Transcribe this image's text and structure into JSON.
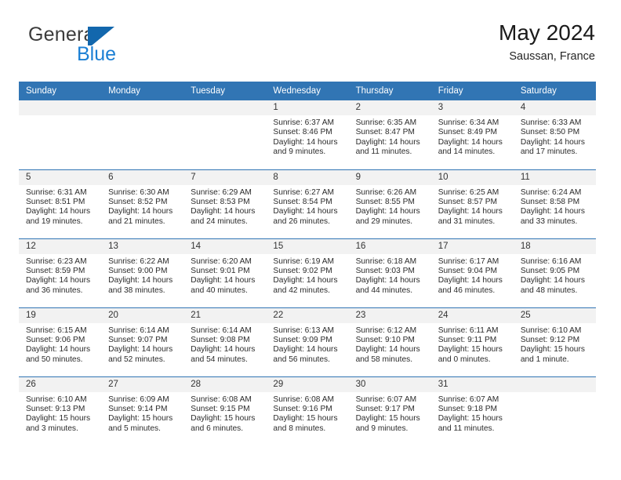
{
  "brand": {
    "name_top": "General",
    "name_bottom": "Blue",
    "flag_icon": "blue-flag-icon",
    "colors": {
      "top_text": "#3c3c3c",
      "bottom_text": "#1b7fd4",
      "flag": "#1267ad"
    }
  },
  "header": {
    "title": "May 2024",
    "subtitle": "Saussan, France"
  },
  "theme": {
    "header_blue": "#3175b4",
    "daynum_band": "#f2f2f2",
    "grid_line": "#3175b4"
  },
  "calendar": {
    "weekday_headers": [
      "Sunday",
      "Monday",
      "Tuesday",
      "Wednesday",
      "Thursday",
      "Friday",
      "Saturday"
    ],
    "weeks": [
      [
        {
          "day": "",
          "blank": true
        },
        {
          "day": "",
          "blank": true
        },
        {
          "day": "",
          "blank": true
        },
        {
          "day": "1",
          "sunrise": "Sunrise: 6:37 AM",
          "sunset": "Sunset: 8:46 PM",
          "daylight_1": "Daylight: 14 hours",
          "daylight_2": "and 9 minutes."
        },
        {
          "day": "2",
          "sunrise": "Sunrise: 6:35 AM",
          "sunset": "Sunset: 8:47 PM",
          "daylight_1": "Daylight: 14 hours",
          "daylight_2": "and 11 minutes."
        },
        {
          "day": "3",
          "sunrise": "Sunrise: 6:34 AM",
          "sunset": "Sunset: 8:49 PM",
          "daylight_1": "Daylight: 14 hours",
          "daylight_2": "and 14 minutes."
        },
        {
          "day": "4",
          "sunrise": "Sunrise: 6:33 AM",
          "sunset": "Sunset: 8:50 PM",
          "daylight_1": "Daylight: 14 hours",
          "daylight_2": "and 17 minutes."
        }
      ],
      [
        {
          "day": "5",
          "sunrise": "Sunrise: 6:31 AM",
          "sunset": "Sunset: 8:51 PM",
          "daylight_1": "Daylight: 14 hours",
          "daylight_2": "and 19 minutes."
        },
        {
          "day": "6",
          "sunrise": "Sunrise: 6:30 AM",
          "sunset": "Sunset: 8:52 PM",
          "daylight_1": "Daylight: 14 hours",
          "daylight_2": "and 21 minutes."
        },
        {
          "day": "7",
          "sunrise": "Sunrise: 6:29 AM",
          "sunset": "Sunset: 8:53 PM",
          "daylight_1": "Daylight: 14 hours",
          "daylight_2": "and 24 minutes."
        },
        {
          "day": "8",
          "sunrise": "Sunrise: 6:27 AM",
          "sunset": "Sunset: 8:54 PM",
          "daylight_1": "Daylight: 14 hours",
          "daylight_2": "and 26 minutes."
        },
        {
          "day": "9",
          "sunrise": "Sunrise: 6:26 AM",
          "sunset": "Sunset: 8:55 PM",
          "daylight_1": "Daylight: 14 hours",
          "daylight_2": "and 29 minutes."
        },
        {
          "day": "10",
          "sunrise": "Sunrise: 6:25 AM",
          "sunset": "Sunset: 8:57 PM",
          "daylight_1": "Daylight: 14 hours",
          "daylight_2": "and 31 minutes."
        },
        {
          "day": "11",
          "sunrise": "Sunrise: 6:24 AM",
          "sunset": "Sunset: 8:58 PM",
          "daylight_1": "Daylight: 14 hours",
          "daylight_2": "and 33 minutes."
        }
      ],
      [
        {
          "day": "12",
          "sunrise": "Sunrise: 6:23 AM",
          "sunset": "Sunset: 8:59 PM",
          "daylight_1": "Daylight: 14 hours",
          "daylight_2": "and 36 minutes."
        },
        {
          "day": "13",
          "sunrise": "Sunrise: 6:22 AM",
          "sunset": "Sunset: 9:00 PM",
          "daylight_1": "Daylight: 14 hours",
          "daylight_2": "and 38 minutes."
        },
        {
          "day": "14",
          "sunrise": "Sunrise: 6:20 AM",
          "sunset": "Sunset: 9:01 PM",
          "daylight_1": "Daylight: 14 hours",
          "daylight_2": "and 40 minutes."
        },
        {
          "day": "15",
          "sunrise": "Sunrise: 6:19 AM",
          "sunset": "Sunset: 9:02 PM",
          "daylight_1": "Daylight: 14 hours",
          "daylight_2": "and 42 minutes."
        },
        {
          "day": "16",
          "sunrise": "Sunrise: 6:18 AM",
          "sunset": "Sunset: 9:03 PM",
          "daylight_1": "Daylight: 14 hours",
          "daylight_2": "and 44 minutes."
        },
        {
          "day": "17",
          "sunrise": "Sunrise: 6:17 AM",
          "sunset": "Sunset: 9:04 PM",
          "daylight_1": "Daylight: 14 hours",
          "daylight_2": "and 46 minutes."
        },
        {
          "day": "18",
          "sunrise": "Sunrise: 6:16 AM",
          "sunset": "Sunset: 9:05 PM",
          "daylight_1": "Daylight: 14 hours",
          "daylight_2": "and 48 minutes."
        }
      ],
      [
        {
          "day": "19",
          "sunrise": "Sunrise: 6:15 AM",
          "sunset": "Sunset: 9:06 PM",
          "daylight_1": "Daylight: 14 hours",
          "daylight_2": "and 50 minutes."
        },
        {
          "day": "20",
          "sunrise": "Sunrise: 6:14 AM",
          "sunset": "Sunset: 9:07 PM",
          "daylight_1": "Daylight: 14 hours",
          "daylight_2": "and 52 minutes."
        },
        {
          "day": "21",
          "sunrise": "Sunrise: 6:14 AM",
          "sunset": "Sunset: 9:08 PM",
          "daylight_1": "Daylight: 14 hours",
          "daylight_2": "and 54 minutes."
        },
        {
          "day": "22",
          "sunrise": "Sunrise: 6:13 AM",
          "sunset": "Sunset: 9:09 PM",
          "daylight_1": "Daylight: 14 hours",
          "daylight_2": "and 56 minutes."
        },
        {
          "day": "23",
          "sunrise": "Sunrise: 6:12 AM",
          "sunset": "Sunset: 9:10 PM",
          "daylight_1": "Daylight: 14 hours",
          "daylight_2": "and 58 minutes."
        },
        {
          "day": "24",
          "sunrise": "Sunrise: 6:11 AM",
          "sunset": "Sunset: 9:11 PM",
          "daylight_1": "Daylight: 15 hours",
          "daylight_2": "and 0 minutes."
        },
        {
          "day": "25",
          "sunrise": "Sunrise: 6:10 AM",
          "sunset": "Sunset: 9:12 PM",
          "daylight_1": "Daylight: 15 hours",
          "daylight_2": "and 1 minute."
        }
      ],
      [
        {
          "day": "26",
          "sunrise": "Sunrise: 6:10 AM",
          "sunset": "Sunset: 9:13 PM",
          "daylight_1": "Daylight: 15 hours",
          "daylight_2": "and 3 minutes."
        },
        {
          "day": "27",
          "sunrise": "Sunrise: 6:09 AM",
          "sunset": "Sunset: 9:14 PM",
          "daylight_1": "Daylight: 15 hours",
          "daylight_2": "and 5 minutes."
        },
        {
          "day": "28",
          "sunrise": "Sunrise: 6:08 AM",
          "sunset": "Sunset: 9:15 PM",
          "daylight_1": "Daylight: 15 hours",
          "daylight_2": "and 6 minutes."
        },
        {
          "day": "29",
          "sunrise": "Sunrise: 6:08 AM",
          "sunset": "Sunset: 9:16 PM",
          "daylight_1": "Daylight: 15 hours",
          "daylight_2": "and 8 minutes."
        },
        {
          "day": "30",
          "sunrise": "Sunrise: 6:07 AM",
          "sunset": "Sunset: 9:17 PM",
          "daylight_1": "Daylight: 15 hours",
          "daylight_2": "and 9 minutes."
        },
        {
          "day": "31",
          "sunrise": "Sunrise: 6:07 AM",
          "sunset": "Sunset: 9:18 PM",
          "daylight_1": "Daylight: 15 hours",
          "daylight_2": "and 11 minutes."
        },
        {
          "day": "",
          "blank": true
        }
      ]
    ]
  }
}
